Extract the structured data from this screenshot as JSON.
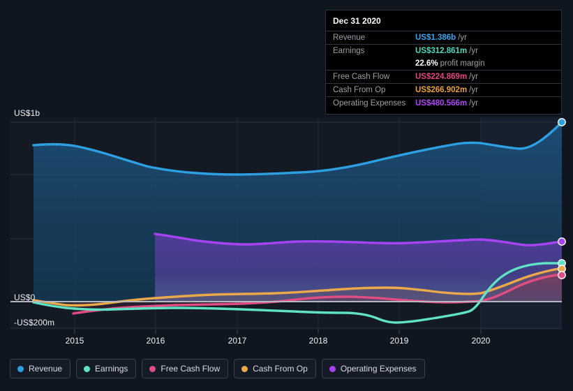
{
  "tooltip": {
    "date": "Dec 31 2020",
    "rows": [
      {
        "label": "Revenue",
        "value": "US$1.386b",
        "unit": "/yr",
        "color": "#3aa7ec"
      },
      {
        "label": "Earnings",
        "value": "US$312.861m",
        "unit": "/yr",
        "color": "#4fd8bd"
      },
      {
        "label": "",
        "value": "22.6%",
        "unit": "profit margin",
        "color": "#ffffff"
      },
      {
        "label": "Free Cash Flow",
        "value": "US$224.869m",
        "unit": "/yr",
        "color": "#e4437f"
      },
      {
        "label": "Cash From Op",
        "value": "US$266.902m",
        "unit": "/yr",
        "color": "#e8a33d"
      },
      {
        "label": "Operating Expenses",
        "value": "US$480.566m",
        "unit": "/yr",
        "color": "#ab46f5"
      }
    ]
  },
  "legend": {
    "items": [
      {
        "label": "Revenue",
        "color": "#2e9fe0"
      },
      {
        "label": "Earnings",
        "color": "#5fe3c4"
      },
      {
        "label": "Free Cash Flow",
        "color": "#df4d83"
      },
      {
        "label": "Cash From Op",
        "color": "#eaa94a"
      },
      {
        "label": "Operating Expenses",
        "color": "#a644f3"
      }
    ]
  },
  "chart_data": {
    "type": "area",
    "title": "",
    "xlabel": "",
    "ylabel": "",
    "grid": true,
    "legend_position": "bottom",
    "ylim": [
      -200000000,
      1000000000
    ],
    "y_ticks": [
      {
        "value": 1000000000,
        "label": "US$1b"
      },
      {
        "value": 666000000,
        "label": ""
      },
      {
        "value": 333000000,
        "label": ""
      },
      {
        "value": 0,
        "label": "US$0"
      },
      {
        "value": -200000000,
        "label": "-US$200m"
      }
    ],
    "x_ticks": [
      "2015",
      "2016",
      "2017",
      "2018",
      "2019",
      "2020"
    ],
    "x_range": [
      "2014-07",
      "2021-03"
    ],
    "units": "USD",
    "series": [
      {
        "name": "Revenue",
        "color": "#2e9fe0",
        "fill": true,
        "x": [
          "2014-09",
          "2015-03",
          "2015-09",
          "2016-03",
          "2016-09",
          "2017-03",
          "2017-09",
          "2018-03",
          "2018-09",
          "2019-03",
          "2019-09",
          "2020-03",
          "2020-06",
          "2020-09",
          "2020-12"
        ],
        "values": [
          0.875,
          0.88,
          0.86,
          0.8,
          0.74,
          0.725,
          0.718,
          0.722,
          0.76,
          0.82,
          0.88,
          0.908,
          0.895,
          0.96,
          1.386
        ],
        "value_unit": "billions USD"
      },
      {
        "name": "Operating Expenses",
        "color": "#a644f3",
        "fill": true,
        "x": [
          "2015-12",
          "2016-06",
          "2016-12",
          "2017-06",
          "2017-12",
          "2018-06",
          "2018-12",
          "2019-06",
          "2019-12",
          "2020-06",
          "2020-12"
        ],
        "values": [
          0.378,
          0.35,
          0.34,
          0.344,
          0.348,
          0.346,
          0.35,
          0.338,
          0.344,
          0.338,
          0.481
        ],
        "value_unit": "billions USD"
      },
      {
        "name": "Cash From Op",
        "color": "#eaa94a",
        "fill": true,
        "x": [
          "2014-09",
          "2015-03",
          "2015-09",
          "2016-03",
          "2016-09",
          "2017-03",
          "2017-09",
          "2018-03",
          "2018-09",
          "2019-03",
          "2019-09",
          "2020-03",
          "2020-09",
          "2020-12"
        ],
        "values": [
          0.01,
          -0.008,
          -0.02,
          -0.016,
          0.03,
          0.048,
          0.05,
          0.055,
          0.075,
          0.072,
          0.05,
          0.045,
          0.12,
          0.267
        ],
        "value_unit": "billions USD"
      },
      {
        "name": "Free Cash Flow",
        "color": "#df4d83",
        "fill": true,
        "x": [
          "2015-04",
          "2015-10",
          "2016-04",
          "2016-10",
          "2017-04",
          "2017-10",
          "2018-04",
          "2018-10",
          "2019-04",
          "2019-10",
          "2020-04",
          "2020-09",
          "2020-12"
        ],
        "values": [
          -0.092,
          -0.06,
          -0.04,
          -0.028,
          -0.02,
          -0.016,
          0.022,
          0.036,
          0.03,
          0.01,
          0.0,
          0.08,
          0.225
        ],
        "value_unit": "billions USD"
      },
      {
        "name": "Earnings",
        "color": "#5fe3c4",
        "fill": true,
        "x": [
          "2014-09",
          "2015-03",
          "2015-09",
          "2016-03",
          "2016-09",
          "2017-03",
          "2017-09",
          "2018-03",
          "2018-09",
          "2019-03",
          "2019-06",
          "2019-12",
          "2020-04",
          "2020-07",
          "2020-12"
        ],
        "values": [
          -0.01,
          -0.036,
          -0.04,
          -0.032,
          -0.03,
          -0.034,
          -0.036,
          -0.04,
          -0.045,
          -0.09,
          -0.098,
          -0.07,
          -0.055,
          0.07,
          0.313
        ],
        "value_unit": "billions USD"
      }
    ]
  }
}
